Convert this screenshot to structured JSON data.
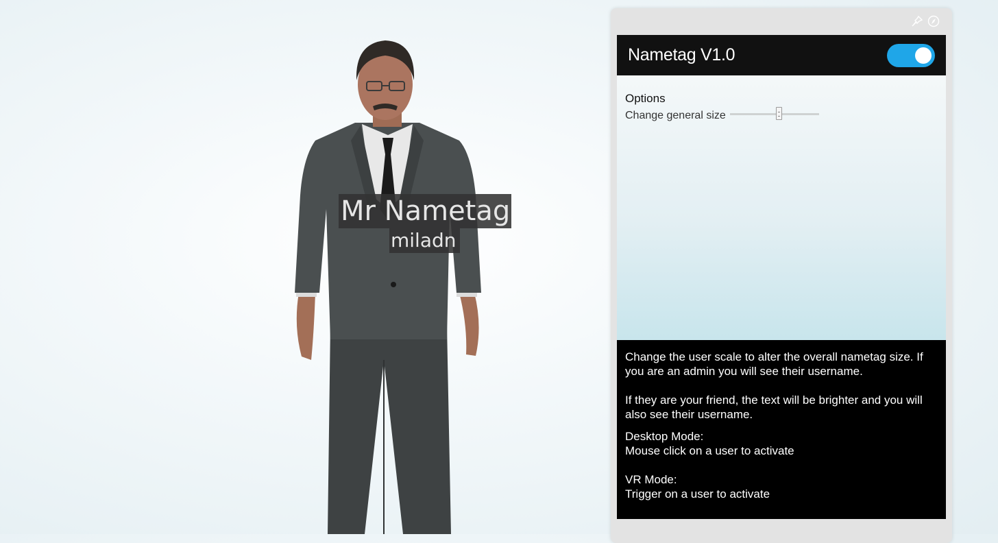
{
  "scene": {
    "display_name": "Mr Nametag",
    "username": "miladn"
  },
  "window": {
    "icons": [
      "pin-icon",
      "compass-icon"
    ]
  },
  "app": {
    "title": "Nametag V1.0",
    "enabled": true,
    "accent_color": "#1fa6e8"
  },
  "options": {
    "title": "Options",
    "size_label": "Change general size",
    "size_value": 0.55
  },
  "help": {
    "p1": "Change the user scale to alter the overall nametag size. If you are an admin you will see their username.",
    "p2": "If they are your friend, the text will be brighter and you will also see their username.",
    "desktop_title": "Desktop Mode:",
    "desktop_text": "Mouse click on a user to activate",
    "vr_title": "VR Mode:",
    "vr_text": "Trigger on a user to activate"
  }
}
